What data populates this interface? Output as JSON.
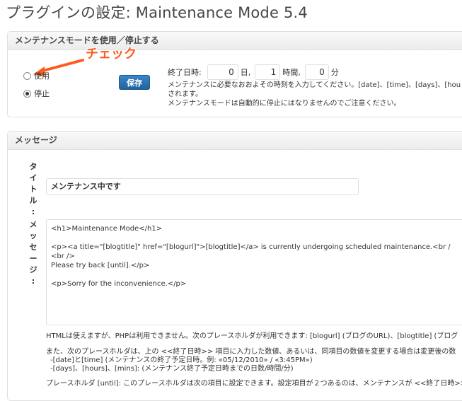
{
  "page_title": "プラグインの設定: Maintenance Mode 5.4",
  "section1": {
    "header": "メンテナンスモードを使用／停止する",
    "annotation": "チェック",
    "radio_use": "使用",
    "radio_stop": "停止",
    "save_label": "保存",
    "end_label": "終了日時:",
    "days_value": "0",
    "days_unit": "日,",
    "hours_value": "1",
    "hours_unit": "時間,",
    "mins_value": "0",
    "mins_unit": "分",
    "help_line1": "メンテナンスに必要なおおよその時刻を入力してください。[date]、[time]、[days]、[hou",
    "help_line2": "されます。",
    "help_line3": "メンテナンスモードは自動的に停止にはなりませんのでご注意ください。"
  },
  "section2": {
    "header": "メッセージ",
    "title_label": "タイトル:",
    "title_value": "メンテナンス中です",
    "message_label": "メッセージ:",
    "message_lines": [
      "<h1>Maintenance Mode</h1>",
      "",
      "<p><a title=\"[blogtitle]\" href=\"[blogurl]\">[blogtitle]</a> is currently undergoing scheduled maintenance.<br /",
      "<br />",
      "Please try back [until].</p>",
      "",
      "<p>Sorry for the inconvenience.</p>"
    ],
    "desc1": "HTMLは使えますが、PHPは利用できません。次のプレースホルダが利用できます: [blogurl] (ブログのURL)、[blogtitle] (ブログ",
    "desc2": "また、次のプレースホルダは、上の <<終了日時>> 項目に入力した数値、あるいは、同項目の数値を変更する場合は変更後の数",
    "desc3": "-[date]と[time] (メンテナンスの終了予定日時。例: «05/12/2010» / «3:45PM»)",
    "desc4": "-[days]、[hours]、[mins]: (メンテナンス終了予定日時までの日数/時間/分)",
    "desc5": "プレースホルダ [until]: このプレースホルダは次の項目に設定できます。設定項目が２つあるのは、メンテナンスが <<終了日時>>"
  }
}
